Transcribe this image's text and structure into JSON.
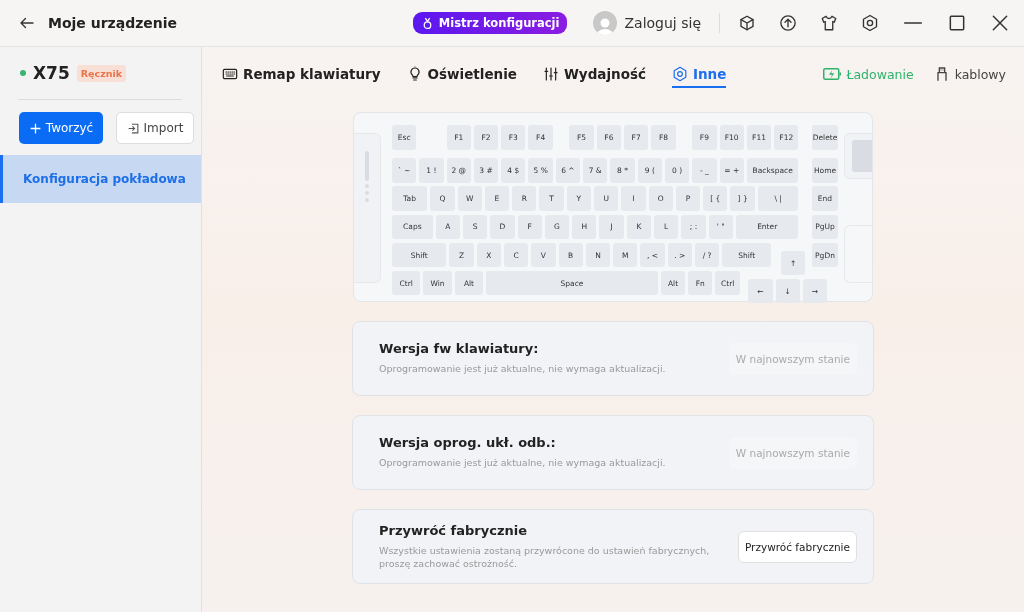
{
  "window": {
    "title": "Moje urządzenie"
  },
  "header": {
    "badge": "Mistrz konfiguracji",
    "login": "Zaloguj się"
  },
  "device": {
    "name": "X75",
    "connected": true,
    "mode": "Ręcznik"
  },
  "sidebar": {
    "buttons": [
      {
        "label": "Tworzyć",
        "kind": "primary"
      },
      {
        "label": "Import",
        "kind": "secondary"
      }
    ],
    "items": [
      {
        "label": "Konfiguracja pokładowa",
        "selected": true
      }
    ]
  },
  "tabs": [
    {
      "label": "Remap klawiatury",
      "selected": false
    },
    {
      "label": "Oświetlenie",
      "selected": false
    },
    {
      "label": "Wydajność",
      "selected": false
    },
    {
      "label": "Inne",
      "selected": true
    }
  ],
  "status": {
    "battery": "Ładowanie",
    "connection": "kablowy"
  },
  "keyboard": {
    "rows": [
      [
        "Esc",
        "F1",
        "F2",
        "F3",
        "F4",
        "F5",
        "F6",
        "F7",
        "F8",
        "F9",
        "F10",
        "F11",
        "F12"
      ],
      [
        "` ~",
        "1 !",
        "2 @",
        "3 #",
        "4 $",
        "5 %",
        "6 ^",
        "7 &",
        "8 *",
        "9 (",
        "0 )",
        "- _",
        "= +",
        "Backspace"
      ],
      [
        "Tab",
        "Q",
        "W",
        "E",
        "R",
        "T",
        "Y",
        "U",
        "I",
        "O",
        "P",
        "[ {",
        "] }",
        "\\ |"
      ],
      [
        "Caps",
        "A",
        "S",
        "D",
        "F",
        "G",
        "H",
        "J",
        "K",
        "L",
        "; :",
        "' \"",
        "Enter"
      ],
      [
        "Shift",
        "Z",
        "X",
        "C",
        "V",
        "B",
        "N",
        "M",
        ", <",
        ". >",
        "/ ?",
        "Shift",
        "↑"
      ],
      [
        "Ctrl",
        "Win",
        "Alt",
        "Space",
        "Alt",
        "Fn",
        "Ctrl",
        "←",
        "↓",
        "→"
      ]
    ],
    "nav": [
      "Delete",
      "Home",
      "End",
      "PgUp",
      "PgDn"
    ]
  },
  "cards": [
    {
      "title": "Wersja fw klawiatury:",
      "description": "Oprogramowanie jest już aktualne, nie wymaga aktualizacji.",
      "button": "W najnowszym stanie",
      "disabled": true
    },
    {
      "title": "Wersja oprog. ukł. odb.:",
      "description": "Oprogramowanie jest już aktualne, nie wymaga aktualizacji.",
      "button": "W najnowszym stanie",
      "disabled": true
    },
    {
      "title": "Przywróć fabrycznie",
      "description": "Wszystkie ustawienia zostaną przywrócone do ustawień fabrycznych, proszę zachować ostrożność.",
      "button": "Przywróć fabrycznie",
      "disabled": false
    }
  ]
}
